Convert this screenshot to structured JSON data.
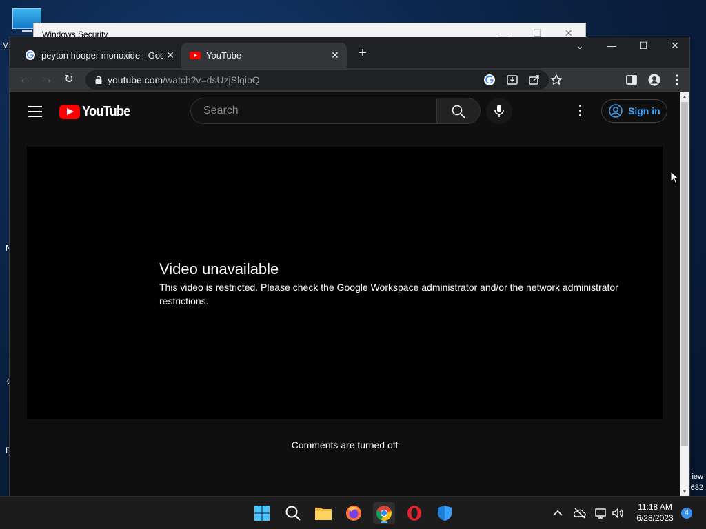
{
  "desktop": {
    "left_letters": [
      "M",
      "N",
      "C",
      "E"
    ],
    "right_texts": [
      "iew",
      "632"
    ]
  },
  "windows_security": {
    "title": "Windows Security",
    "controls": {
      "minimize": "—",
      "maximize": "☐",
      "close": "✕"
    }
  },
  "browser": {
    "tabs": [
      {
        "title": "peyton hooper monoxide - Google Search",
        "favicon": "google-icon",
        "active": false
      },
      {
        "title": "YouTube",
        "favicon": "youtube-icon",
        "active": true
      }
    ],
    "new_tab": "+",
    "tab_close": "✕",
    "window_controls": {
      "tab_search": "⌄",
      "minimize": "—",
      "maximize": "☐",
      "close": "✕"
    },
    "nav": {
      "back": "←",
      "forward": "→",
      "reload": "↻"
    },
    "address": {
      "host": "youtube.com",
      "path": "/watch?v=dsUzjSlqibQ"
    }
  },
  "youtube": {
    "logo_text": "YouTube",
    "search_placeholder": "Search",
    "sign_in": "Sign in",
    "error_title": "Video unavailable",
    "error_message": "This video is restricted. Please check the Google Workspace administrator and/or the network administrator restrictions.",
    "comments_status": "Comments are turned off"
  },
  "taskbar": {
    "apps": [
      "start-icon",
      "search-icon",
      "file-explorer-icon",
      "firefox-icon",
      "chrome-icon",
      "opera-icon",
      "defender-icon"
    ],
    "active_app": "chrome-icon",
    "time": "11:18 AM",
    "date": "6/28/2023",
    "notification_count": "4"
  },
  "colors": {
    "youtube_red": "#ff0000",
    "link_blue": "#3ea6ff",
    "page_bg": "#0f0f0f",
    "tab_active": "#35363a"
  }
}
